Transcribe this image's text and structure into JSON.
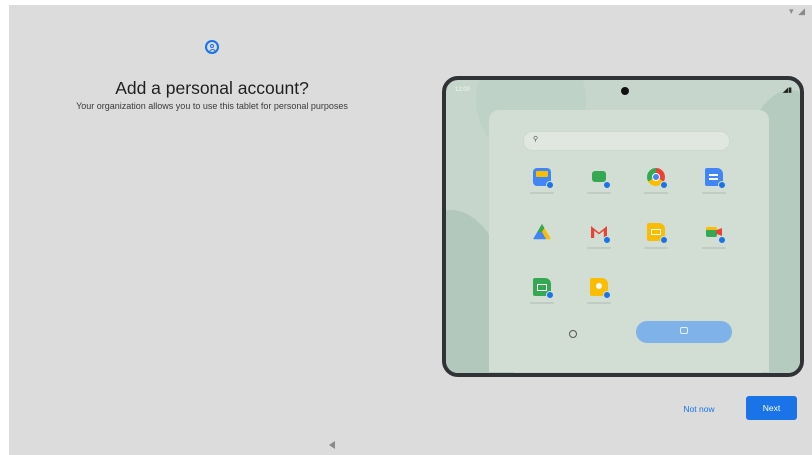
{
  "status_icons": "▾ ◢",
  "setup": {
    "icon": "account-circle-icon",
    "title": "Add a personal account?",
    "subtitle": "Your organization allows you to use this tablet for personal purposes"
  },
  "illustration": {
    "time": "12:00",
    "signal": "◢▮",
    "search_icon": "search-icon",
    "apps": [
      "calendar",
      "messages",
      "chrome",
      "docs",
      "drive",
      "gmail",
      "slides",
      "meet",
      "sheets",
      "keep"
    ]
  },
  "buttons": {
    "not_now": "Not now",
    "next": "Next"
  },
  "nav": {
    "back": "back-icon"
  },
  "colors": {
    "accent": "#1a73e8",
    "background": "#dcdcdc"
  }
}
